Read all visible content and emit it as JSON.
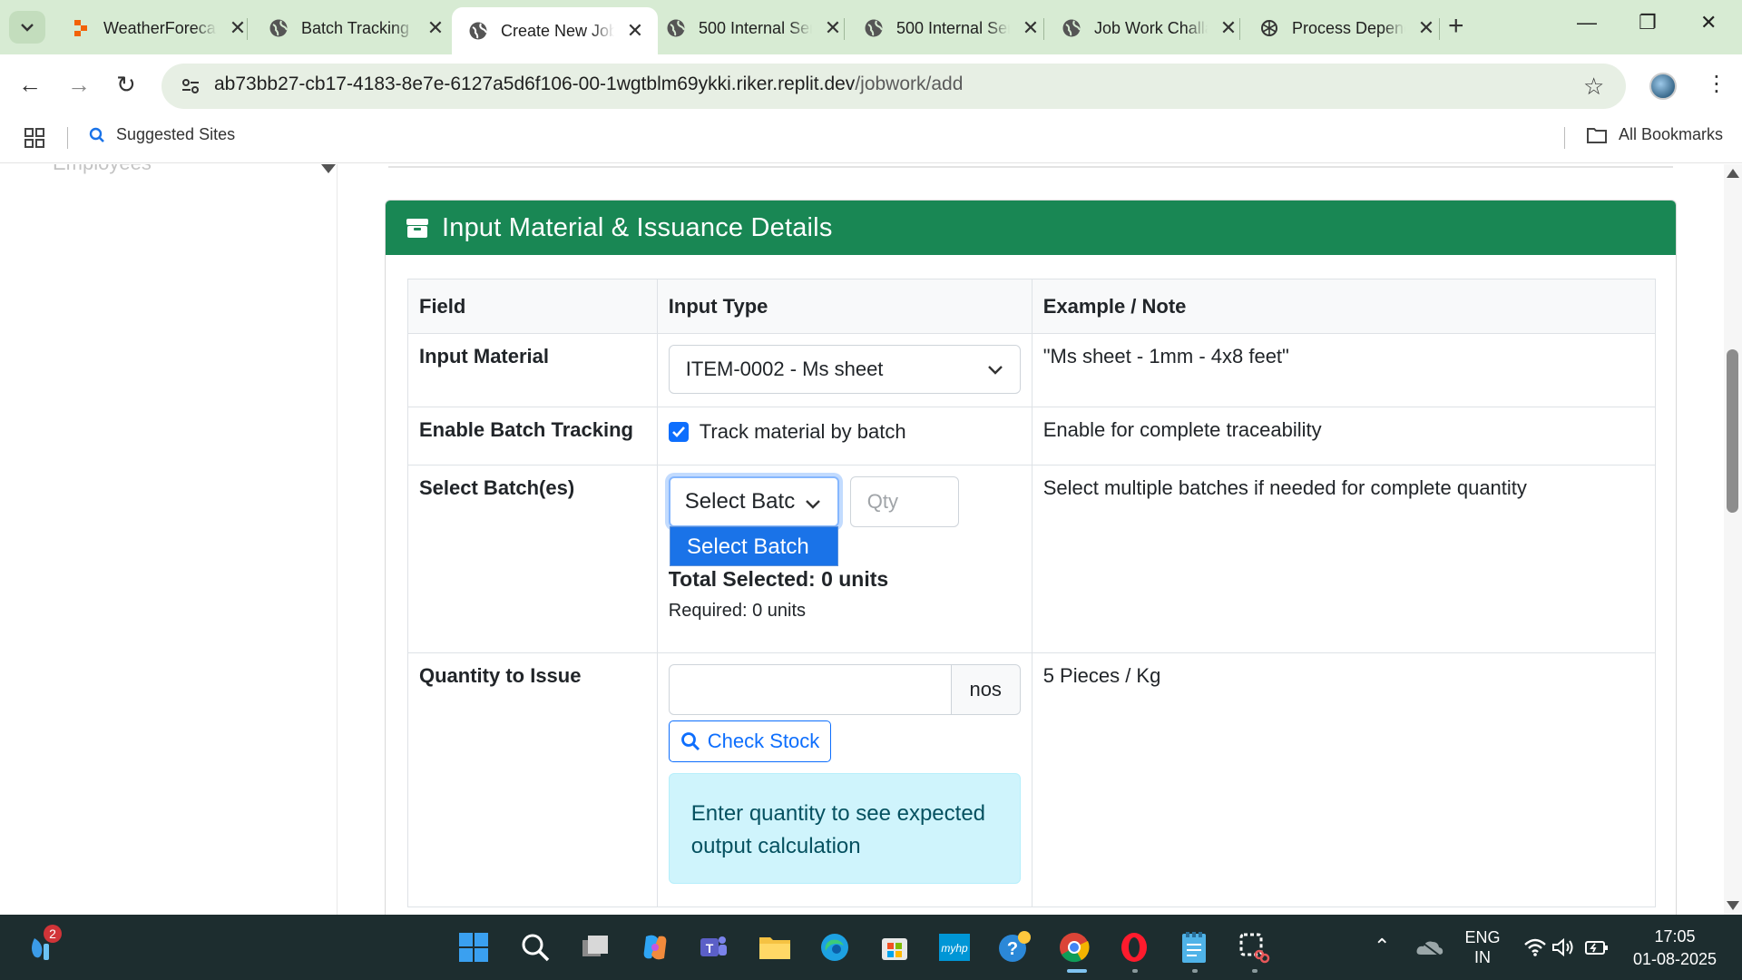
{
  "browser": {
    "tabs": [
      {
        "title": "WeatherForecast",
        "icon": "replit-icon"
      },
      {
        "title": "Batch Tracking",
        "icon": "globe-icon"
      },
      {
        "title": "Create New Job Work",
        "icon": "globe-icon"
      },
      {
        "title": "500 Internal Server",
        "icon": "globe-icon"
      },
      {
        "title": "500 Internal Server",
        "icon": "globe-icon"
      },
      {
        "title": "Job Work Challan",
        "icon": "globe-icon"
      },
      {
        "title": "Process Dependency",
        "icon": "openai-icon"
      }
    ],
    "active_tab": 2,
    "url_host": "ab73bb27-cb17-4183-8e7e-6127a5d6f106-00-1wgtblm69ykki.riker.replit.dev",
    "url_path": "/jobwork/add",
    "bookmarks": {
      "suggested": "Suggested Sites",
      "all": "All Bookmarks"
    }
  },
  "sidebar": {
    "partial_item": "Employees"
  },
  "card": {
    "title": "Input Material & Issuance Details",
    "header_color": "#198754",
    "columns": [
      "Field",
      "Input Type",
      "Example / Note"
    ],
    "rows": {
      "input_material": {
        "label": "Input Material",
        "value": "ITEM-0002 - Ms sheet",
        "note": "\"Ms sheet - 1mm - 4x8 feet\""
      },
      "batch_tracking": {
        "label": "Enable Batch Tracking",
        "checkbox_label": "Track material by batch",
        "checked": true,
        "note": "Enable for complete traceability"
      },
      "select_batches": {
        "label": "Select Batch(es)",
        "select_value": "Select Batc",
        "qty_placeholder": "Qty",
        "dropdown_option": "Select Batch",
        "total": "Total Selected: 0 units",
        "required": "Required: 0 units",
        "note": "Select multiple batches if needed for complete quantity"
      },
      "quantity": {
        "label": "Quantity to Issue",
        "value": "",
        "unit": "nos",
        "button": "Check Stock",
        "info": "Enter quantity to see expected output calculation",
        "note": "5 Pieces / Kg"
      }
    }
  },
  "taskbar": {
    "notification_count": "2",
    "lang_top": "ENG",
    "lang_bottom": "IN",
    "time": "17:05",
    "date": "01-08-2025"
  }
}
